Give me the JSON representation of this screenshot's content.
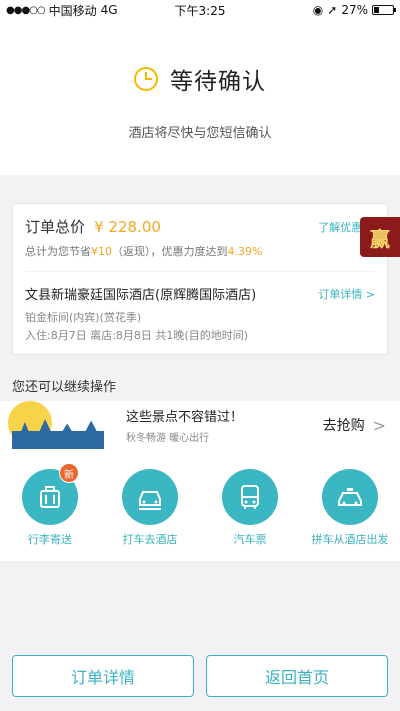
{
  "status_bar": {
    "signal": "●●●○○",
    "carrier": "中国移动",
    "network": "4G",
    "time": "下午3:25",
    "battery": "27%",
    "battery_level": 0.27
  },
  "header": {
    "title": "等待确认",
    "subtitle": "酒店将尽快与您短信确认"
  },
  "order": {
    "total_label": "订单总价",
    "total_price": "¥ 228.00",
    "learn_offer": "了解优惠",
    "saving_prefix": "总计为您节省",
    "saving_amount": "¥10",
    "saving_mid": "（返现），优惠力度达到",
    "saving_percent": "4.39%",
    "hotel_name": "文县新瑞豪廷国际酒店(原辉腾国际酒店)",
    "order_detail_link": "订单详情",
    "room_type": "铂金标间(内宾)(赏花季)",
    "stay_dates": "入住:8月7日  离店:8月8日  共1晚(目的地时间)"
  },
  "side_badge": "赢",
  "section_title": "您还可以继续操作",
  "promo": {
    "title": "这些景点不容错过！",
    "subtitle": "秋冬畅游 暖心出行",
    "action": "去抢购"
  },
  "services": [
    {
      "label": "行李寄送",
      "icon": "luggage-icon",
      "badge": "新"
    },
    {
      "label": "打车去酒店",
      "icon": "taxi-icon"
    },
    {
      "label": "汽车票",
      "icon": "bus-icon"
    },
    {
      "label": "拼车从酒店出发",
      "icon": "carpool-icon"
    }
  ],
  "bottom": {
    "order_detail": "订单详情",
    "back_home": "返回首页"
  },
  "colors": {
    "accent": "#39b3c0",
    "price": "#f5a623",
    "badge": "#e9672e"
  }
}
